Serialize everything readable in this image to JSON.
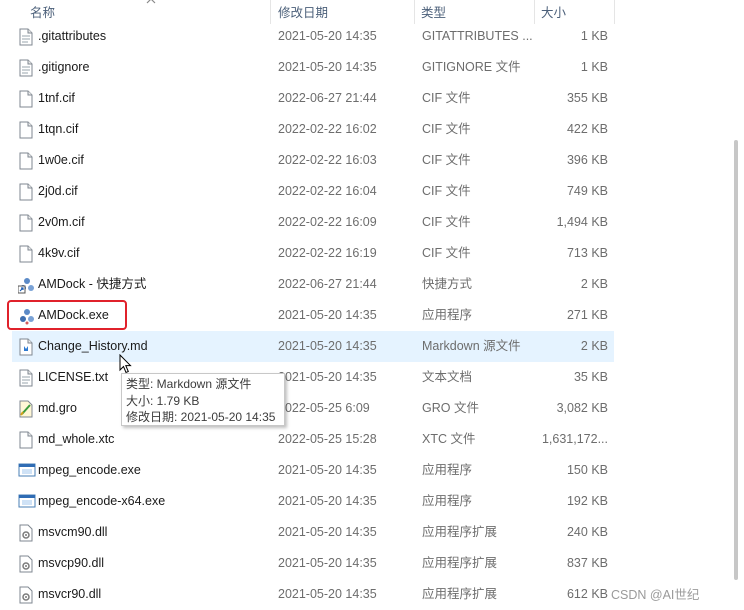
{
  "columns": {
    "name": "名称",
    "date": "修改日期",
    "type": "类型",
    "size": "大小"
  },
  "files": [
    {
      "name": ".gitattributes",
      "date": "2021-05-20 14:35",
      "type": "GITATTRIBUTES ...",
      "size": "1 KB",
      "icon": "text-file-icon"
    },
    {
      "name": ".gitignore",
      "date": "2021-05-20 14:35",
      "type": "GITIGNORE 文件",
      "size": "1 KB",
      "icon": "text-file-icon"
    },
    {
      "name": "1tnf.cif",
      "date": "2022-06-27 21:44",
      "type": "CIF 文件",
      "size": "355 KB",
      "icon": "blank-file-icon"
    },
    {
      "name": "1tqn.cif",
      "date": "2022-02-22 16:02",
      "type": "CIF 文件",
      "size": "422 KB",
      "icon": "blank-file-icon"
    },
    {
      "name": "1w0e.cif",
      "date": "2022-02-22 16:03",
      "type": "CIF 文件",
      "size": "396 KB",
      "icon": "blank-file-icon"
    },
    {
      "name": "2j0d.cif",
      "date": "2022-02-22 16:04",
      "type": "CIF 文件",
      "size": "749 KB",
      "icon": "blank-file-icon"
    },
    {
      "name": "2v0m.cif",
      "date": "2022-02-22 16:09",
      "type": "CIF 文件",
      "size": "1,494 KB",
      "icon": "blank-file-icon"
    },
    {
      "name": "4k9v.cif",
      "date": "2022-02-22 16:19",
      "type": "CIF 文件",
      "size": "713 KB",
      "icon": "blank-file-icon"
    },
    {
      "name": "AMDock - 快捷方式",
      "date": "2022-06-27 21:44",
      "type": "快捷方式",
      "size": "2 KB",
      "icon": "amdock-shortcut-icon"
    },
    {
      "name": "AMDock.exe",
      "date": "2021-05-20 14:35",
      "type": "应用程序",
      "size": "271 KB",
      "icon": "amdock-app-icon"
    },
    {
      "name": "Change_History.md",
      "date": "2021-05-20 14:35",
      "type": "Markdown 源文件",
      "size": "2 KB",
      "icon": "markdown-file-icon"
    },
    {
      "name": "LICENSE.txt",
      "date": "2021-05-20 14:35",
      "type": "文本文档",
      "size": "35 KB",
      "icon": "text-file-icon"
    },
    {
      "name": "md.gro",
      "date": "2022-05-25 6:09",
      "type": "GRO 文件",
      "size": "3,082 KB",
      "icon": "gro-file-icon"
    },
    {
      "name": "md_whole.xtc",
      "date": "2022-05-25 15:28",
      "type": "XTC 文件",
      "size": "1,631,172...",
      "icon": "blank-file-icon"
    },
    {
      "name": "mpeg_encode.exe",
      "date": "2021-05-20 14:35",
      "type": "应用程序",
      "size": "150 KB",
      "icon": "exe-icon"
    },
    {
      "name": "mpeg_encode-x64.exe",
      "date": "2021-05-20 14:35",
      "type": "应用程序",
      "size": "192 KB",
      "icon": "exe-icon"
    },
    {
      "name": "msvcm90.dll",
      "date": "2021-05-20 14:35",
      "type": "应用程序扩展",
      "size": "240 KB",
      "icon": "dll-icon"
    },
    {
      "name": "msvcp90.dll",
      "date": "2021-05-20 14:35",
      "type": "应用程序扩展",
      "size": "837 KB",
      "icon": "dll-icon"
    },
    {
      "name": "msvcr90.dll",
      "date": "2021-05-20 14:35",
      "type": "应用程序扩展",
      "size": "612 KB",
      "icon": "dll-icon"
    }
  ],
  "tooltip": {
    "type_line": "类型: Markdown 源文件",
    "size_line": "大小: 1.79 KB",
    "date_line": "修改日期: 2021-05-20 14:35"
  },
  "watermark": "CSDN @AI世纪",
  "colors": {
    "highlight_border": "#e0212b",
    "hover_row": "#e5f3ff",
    "header_text": "#4c607a"
  }
}
